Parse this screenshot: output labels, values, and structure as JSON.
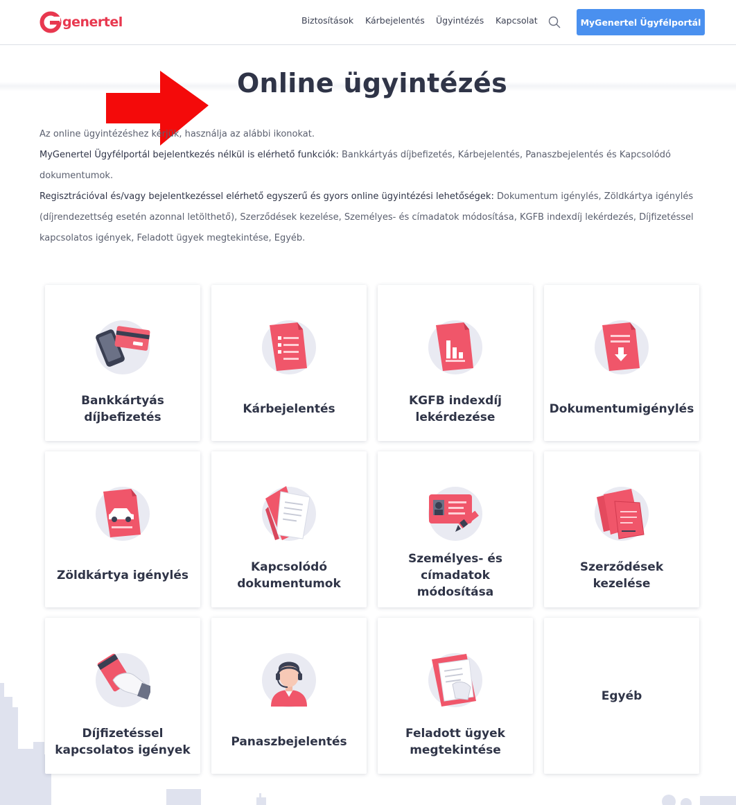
{
  "header": {
    "logo_text": "genertel",
    "nav": [
      {
        "label": "Biztosítások"
      },
      {
        "label": "Kárbejelentés"
      },
      {
        "label": "Ügyintézés"
      },
      {
        "label": "Kapcsolat"
      }
    ],
    "search_icon": "search-icon",
    "portal_button": "MyGenertel Ügyfélportál"
  },
  "page": {
    "title": "Online ügyintézés",
    "intro": {
      "line1": "Az online ügyintézéshez kérjük, használja az alábbi ikonokat.",
      "p2_bold": "MyGenertel Ügyfélportál bejelentkezés nélkül is elérhető funkciók:",
      "p2_text": " Bankkártyás díjbefizetés, Kárbejelentés, Panaszbejelentés és Kapcsolódó dokumentumok.",
      "p3_bold": "Regisztrációval és/vagy bejelentkezéssel elérhető egyszerű és gyors online ügyintézési lehetőségek:",
      "p3_text": " Dokumentum igénylés, Zöldkártya igénylés (díjrendezettség esetén azonnal letölthető), Szerződések kezelése, Személyes- és címadatok módosítása, KGFB indexdíj lekérdezés, Díjfizetéssel kapcsolatos igények, Feladott ügyek megtekintése, Egyéb."
    }
  },
  "cards": [
    {
      "label": "Bankkártyás díjbefizetés",
      "icon": "credit-card-phone-icon"
    },
    {
      "label": "Kárbejelentés",
      "icon": "document-list-icon"
    },
    {
      "label": "KGFB indexdíj lekérdezése",
      "icon": "document-chart-icon"
    },
    {
      "label": "Dokumentumigénylés",
      "icon": "document-download-icon"
    },
    {
      "label": "Zöldkártya igénylés",
      "icon": "car-document-icon"
    },
    {
      "label": "Kapcsolódó dokumentumok",
      "icon": "folder-documents-icon"
    },
    {
      "label": "Személyes- és címadatok módosítása",
      "icon": "id-card-pen-icon"
    },
    {
      "label": "Szerződések kezelése",
      "icon": "contract-documents-icon"
    },
    {
      "label": "Díjfizetéssel kapcsolatos igények",
      "icon": "hand-card-icon"
    },
    {
      "label": "Panaszbejelentés",
      "icon": "support-agent-icon"
    },
    {
      "label": "Feladott ügyek megtekintése",
      "icon": "submitted-documents-icon"
    },
    {
      "label": "Egyéb",
      "icon": ""
    }
  ],
  "colors": {
    "brand_red": "#e8384f",
    "accent_blue": "#4a90ef",
    "text_dark": "#2f3447"
  }
}
